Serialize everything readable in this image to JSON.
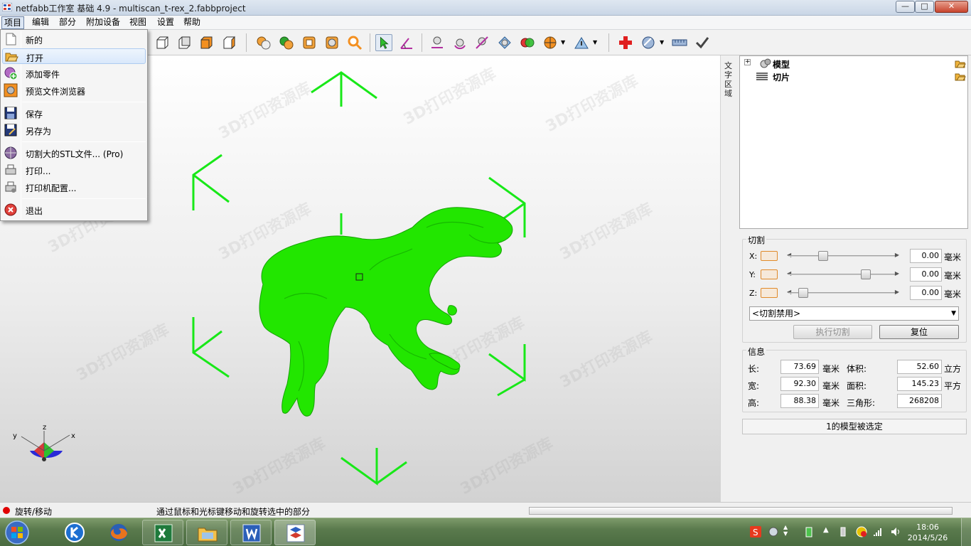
{
  "window": {
    "title": "netfabb工作室 基础 4.9 - multiscan_t-rex_2.fabbproject",
    "minimize_icon": "minimize-icon",
    "maximize_icon": "maximize-icon",
    "close_icon": "close-icon"
  },
  "menubar": {
    "items": [
      {
        "label": "项目"
      },
      {
        "label": "编辑"
      },
      {
        "label": "部分"
      },
      {
        "label": "附加设备"
      },
      {
        "label": "视图"
      },
      {
        "label": "设置"
      },
      {
        "label": "帮助"
      }
    ],
    "active": "项目"
  },
  "project_menu": {
    "items": [
      {
        "label": "新的",
        "icon": "new-file-icon"
      },
      {
        "label": "打开",
        "icon": "open-folder-icon",
        "highlighted": true
      },
      {
        "label": "添加零件",
        "icon": "add-part-icon"
      },
      {
        "label": "预览文件浏览器",
        "icon": "file-browser-icon"
      },
      {
        "label": "保存",
        "icon": "save-icon"
      },
      {
        "label": "另存为",
        "icon": "save-as-icon"
      },
      {
        "label": "切割大的STL文件... (Pro)",
        "icon": "cut-stl-icon"
      },
      {
        "label": "打印...",
        "icon": "print-icon"
      },
      {
        "label": "打印机配置...",
        "icon": "printer-config-icon"
      },
      {
        "label": "退出",
        "icon": "exit-icon"
      }
    ]
  },
  "side_panel": {
    "label": "文字区域",
    "tree": [
      {
        "label": "模型",
        "icon": "model-icon",
        "action_icon": "folder-open-icon"
      },
      {
        "label": "切片",
        "icon": "slice-icon",
        "action_icon": "folder-open-icon"
      }
    ]
  },
  "cut": {
    "title": "切割",
    "axes": [
      {
        "label": "X:",
        "value": "0.00",
        "unit": "毫米",
        "slider": 0.3
      },
      {
        "label": "Y:",
        "value": "0.00",
        "unit": "毫米",
        "slider": 0.73
      },
      {
        "label": "Z:",
        "value": "0.00",
        "unit": "毫米",
        "slider": 0.1
      }
    ],
    "mode": "<切割禁用>",
    "execute_label": "执行切割",
    "reset_label": "复位"
  },
  "info": {
    "title": "信息",
    "rows": [
      {
        "label": "长:",
        "value": "73.69",
        "unit": "毫米",
        "label2": "体积:",
        "value2": "52.60",
        "unit2": "立方"
      },
      {
        "label": "宽:",
        "value": "92.30",
        "unit": "毫米",
        "label2": "面积:",
        "value2": "145.23",
        "unit2": "平方"
      },
      {
        "label": "高:",
        "value": "88.38",
        "unit": "毫米",
        "label2": "三角形:",
        "value2": "268208",
        "unit2": ""
      }
    ]
  },
  "selection_status": "1的模型被选定",
  "axis_gizmo": {
    "x": "x",
    "y": "y",
    "z": "z"
  },
  "statusbar": {
    "mode": "旋转/移动",
    "hint": "通过鼠标和光标键移动和旋转选中的部分"
  },
  "taskbar": {
    "time": "18:06",
    "date": "2014/5/26",
    "apps": [
      "start-orb-icon",
      "kingsoft-icon",
      "firefox-icon",
      "excel-icon",
      "explorer-icon",
      "word-icon",
      "netfabb-icon"
    ]
  },
  "colors": {
    "model": "#22e600",
    "gizmo": "#18e818",
    "accent": "#e08a2a"
  }
}
